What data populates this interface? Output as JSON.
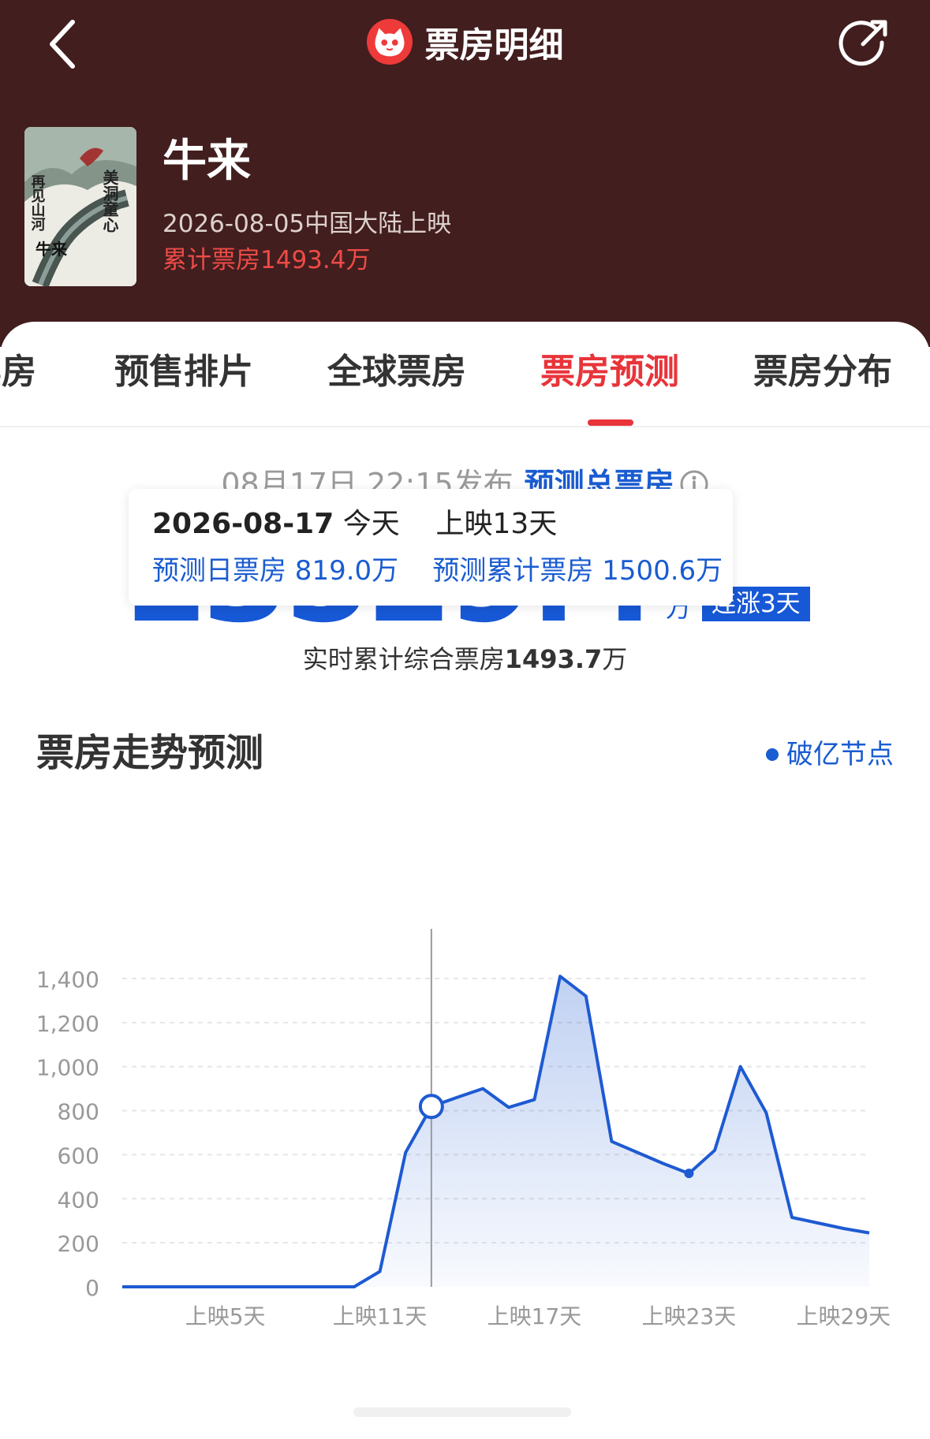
{
  "header": {
    "title": "票房明细",
    "back_icon": "chevron-left-icon",
    "share_icon": "share-icon",
    "logo_icon": "cat-logo-icon",
    "background_color": "#421e1e"
  },
  "movie": {
    "title": "牛来",
    "release": "2026-08-05中国大陆上映",
    "cumulative": "累计票房1493.4万",
    "poster": {
      "title": "牛来",
      "calligraphy_right": "美洞童心",
      "calligraphy_left": "再见山河"
    }
  },
  "tabs": [
    {
      "label": "票房",
      "active": false
    },
    {
      "label": "预售排片",
      "active": false
    },
    {
      "label": "全球票房",
      "active": false
    },
    {
      "label": "票房预测",
      "active": true
    },
    {
      "label": "票房分布",
      "active": false
    }
  ],
  "forecast": {
    "publish_time": "08月17日 22:15发布",
    "label": "预测总票房",
    "value": "13529.4",
    "unit": "万",
    "badge": "连涨3天",
    "realtime_prefix": "实时累计综合票房",
    "realtime_value": "1493.7",
    "realtime_unit": "万"
  },
  "trend": {
    "title": "票房走势预测",
    "legend": "破亿节点",
    "tooltip": {
      "date": "2026-08-17",
      "today": "今天",
      "days": "上映13天",
      "daily": "预测日票房 819.0万",
      "cumulative": "预测累计票房 1500.6万"
    }
  },
  "chart_data": {
    "type": "area",
    "title": "",
    "xlabel": "",
    "ylabel": "",
    "ylim": [
      0,
      1400
    ],
    "yticks": [
      0,
      200,
      400,
      600,
      800,
      1000,
      1200,
      1400
    ],
    "ytick_labels": [
      "0",
      "200",
      "400",
      "600",
      "800",
      "1,000",
      "1,200",
      "1,400"
    ],
    "xtick_labels": [
      "上映5天",
      "上映11天",
      "上映17天",
      "上映23天",
      "上映29天"
    ],
    "xtick_days": [
      5,
      11,
      17,
      23,
      29
    ],
    "x_range": [
      1,
      30
    ],
    "grid": true,
    "color": "#1e5ad2",
    "highlight_day": 13,
    "highlight_value": 819.0,
    "marked_day": 23,
    "series": [
      {
        "days": [
          1,
          2,
          3,
          4,
          5,
          6,
          7,
          8,
          9,
          10,
          11,
          12,
          13,
          14,
          15,
          16,
          17,
          18,
          19,
          20,
          21,
          22,
          23,
          24,
          25,
          26,
          27,
          28,
          29,
          30
        ],
        "values": [
          0,
          0,
          0,
          0,
          0,
          0,
          0,
          0,
          0,
          0,
          70,
          610,
          819,
          860,
          900,
          815,
          850,
          1410,
          1320,
          660,
          610,
          560,
          515,
          620,
          1000,
          790,
          315,
          290,
          265,
          245
        ]
      }
    ]
  }
}
